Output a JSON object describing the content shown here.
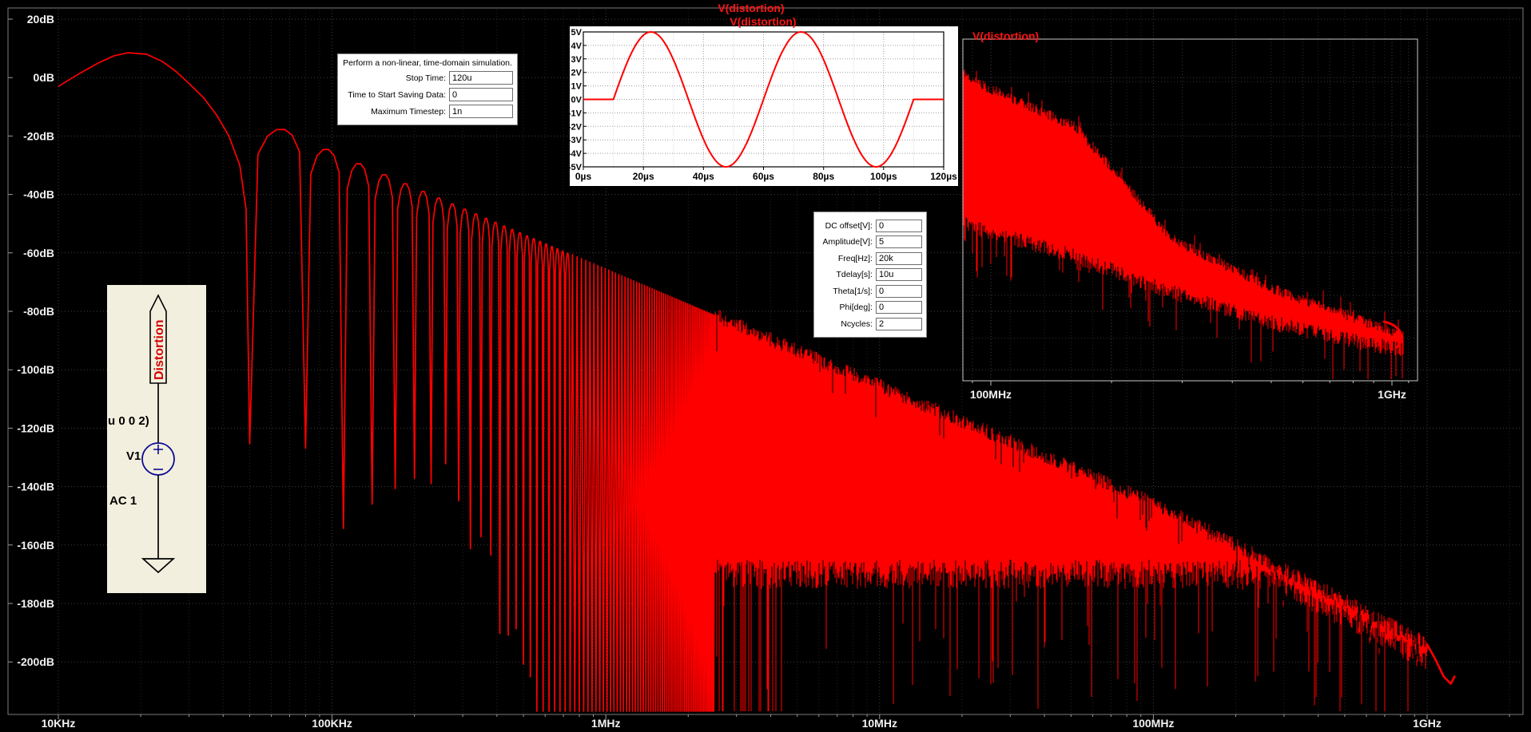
{
  "window": {
    "app": "LTspice waveform viewer",
    "bg": "#000000"
  },
  "titles": {
    "main": "V(distortion)",
    "time_inset": "V(distortion)",
    "hf_inset": "V(distortion)"
  },
  "colors": {
    "trace": "#ff0000",
    "grid_major": "#414141",
    "grid_minor": "#262626",
    "frame": "#7d7d7d",
    "axis_text": "#f2f2f2",
    "inset_frame": "#000000",
    "hf_frame": "#c8c8c8",
    "schematic_bg": "#f3efde",
    "schematic_navy": "#0a0a96",
    "net_label_red": "#d40000"
  },
  "chart_data": [
    {
      "id": "main-fft",
      "type": "line",
      "title": "V(distortion)",
      "grid": true,
      "x_axis": {
        "scale": "log",
        "unit": "Hz",
        "min": 10000,
        "max": 2200000000,
        "tick_hz": [
          10000,
          100000,
          1000000,
          10000000,
          100000000,
          1000000000
        ],
        "tick_labels": [
          "10KHz",
          "100KHz",
          "1MHz",
          "10MHz",
          "100MHz",
          "1GHz"
        ]
      },
      "y_axis": {
        "unit": "dB",
        "min": -217,
        "max": 20,
        "step": 20,
        "tick_db": [
          20,
          0,
          -20,
          -40,
          -60,
          -80,
          -100,
          -120,
          -140,
          -160,
          -180,
          -200
        ],
        "tick_labels": [
          "20dB",
          "0dB",
          "-20dB",
          "-40dB",
          "-60dB",
          "-80dB",
          "-100dB",
          "-120dB",
          "-140dB",
          "-160dB",
          "-180dB",
          "-200dB"
        ]
      },
      "series": [
        {
          "name": "V(distortion)",
          "description": "FFT magnitude of a 2-cycle 20kHz sine burst; lobed spectrum decaying into dense noise band",
          "main_lobe_points_hz_db": [
            [
              10000,
              -3
            ],
            [
              12000,
              1.5
            ],
            [
              14000,
              5
            ],
            [
              16000,
              7.5
            ],
            [
              18000,
              8.5
            ],
            [
              21000,
              8
            ],
            [
              24000,
              5.5
            ],
            [
              27000,
              2
            ],
            [
              30000,
              -2
            ],
            [
              34000,
              -7
            ],
            [
              38000,
              -13
            ],
            [
              42000,
              -20
            ],
            [
              46000,
              -30
            ],
            [
              48500,
              -45
            ]
          ],
          "first_null_hz": 50000,
          "null_spacing_hz": 30000,
          "lobe_envelope": {
            "ref_hz": 65000,
            "ref_db": -18,
            "slope_db_per_decade": -40
          },
          "high_freq_envelope": {
            "from_hz": 100000000,
            "from_db": -145.5,
            "slope_db_per_decade": -48
          },
          "null_depth_db_range": [
            -155,
            -125
          ],
          "deep_null_band_hz": [
            600000,
            2500000
          ],
          "noise_floor_db": -170,
          "floor_rolloff": {
            "from_hz": 250000000,
            "to_hz": 1000000000,
            "to_db": -199
          },
          "end_hz": 1000000000,
          "tail_hook_hz_db": [
            [
              1000000000,
              -194
            ],
            [
              1070000000,
              -199
            ],
            [
              1150000000,
              -205
            ],
            [
              1220000000,
              -207.5
            ],
            [
              1260000000,
              -205
            ]
          ]
        }
      ]
    },
    {
      "id": "time-inset",
      "type": "line",
      "title": "V(distortion)",
      "grid": true,
      "x_axis": {
        "unit": "us",
        "min": 0,
        "max": 120,
        "tick_us": [
          0,
          20,
          40,
          60,
          80,
          100,
          120
        ],
        "tick_labels": [
          "0µs",
          "20µs",
          "40µs",
          "60µs",
          "80µs",
          "100µs",
          "120µs"
        ]
      },
      "y_axis": {
        "unit": "V",
        "min": -5,
        "max": 5,
        "tick_v": [
          5,
          4,
          3,
          2,
          1,
          0,
          -1,
          -2,
          -3,
          -4,
          -5
        ],
        "tick_labels": [
          "5V",
          "4V",
          "3V",
          "2V",
          "1V",
          "0V",
          "-1V",
          "-2V",
          "-3V",
          "-4V",
          "-5V"
        ]
      },
      "series": [
        {
          "name": "V(distortion)",
          "waveform": "sine-burst",
          "amplitude_v": 5,
          "freq_hz": 20000,
          "delay_us": 10,
          "cycles": 2,
          "key_points_us_v": [
            [
              0,
              0
            ],
            [
              10,
              0
            ],
            [
              22.5,
              5
            ],
            [
              35,
              0
            ],
            [
              47.5,
              -5
            ],
            [
              60,
              0
            ],
            [
              72.5,
              5
            ],
            [
              85,
              0
            ],
            [
              97.5,
              -5
            ],
            [
              110,
              0
            ],
            [
              120,
              0
            ]
          ]
        }
      ]
    },
    {
      "id": "hf-fft-inset",
      "type": "line",
      "title": "V(distortion)",
      "grid": true,
      "x_axis": {
        "scale": "log",
        "unit": "Hz",
        "min": 89000000,
        "max": 1140000000,
        "tick_hz": [
          100000000,
          1000000000
        ],
        "tick_labels": [
          "100MHz",
          "1GHz"
        ]
      },
      "y_axis": {
        "unit": "dB",
        "tick_labels": []
      },
      "series": [
        {
          "name": "V(distortion)",
          "description": "dense FFT noise band descending from upper-left to lower-right",
          "band_top": [
            [
              0,
              0.1
            ],
            [
              0.033,
              0.129
            ],
            [
              0.248,
              0.257
            ],
            [
              0.462,
              0.586
            ],
            [
              0.677,
              0.729
            ],
            [
              0.891,
              0.83
            ],
            [
              0.978,
              0.872
            ]
          ],
          "band_bottom": [
            [
              0,
              0.53
            ],
            [
              0.033,
              0.556
            ],
            [
              0.248,
              0.636
            ],
            [
              0.462,
              0.743
            ],
            [
              0.677,
              0.83
            ],
            [
              0.891,
              0.893
            ],
            [
              0.978,
              0.91
            ]
          ]
        }
      ]
    }
  ],
  "sim_dialog": {
    "header": "Perform a non-linear, time-domain simulation.",
    "rows": [
      {
        "label": "Stop Time:",
        "value": "120u"
      },
      {
        "label": "Time to Start Saving Data:",
        "value": "0"
      },
      {
        "label": "Maximum Timestep:",
        "value": "1n"
      }
    ]
  },
  "source_dialog": {
    "rows": [
      {
        "label": "DC offset[V]:",
        "value": "0"
      },
      {
        "label": "Amplitude[V]:",
        "value": "5"
      },
      {
        "label": "Freq[Hz]:",
        "value": "20k"
      },
      {
        "label": "Tdelay[s]:",
        "value": "10u"
      },
      {
        "label": "Theta[1/s]:",
        "value": "0"
      },
      {
        "label": "Phi[deg]:",
        "value": "0"
      },
      {
        "label": "Ncycles:",
        "value": "2"
      }
    ]
  },
  "schematic": {
    "net_label": "Distortion",
    "spice_text_fragment": "u 0 0 2)",
    "component_name": "V1",
    "component_value": "AC 1"
  }
}
